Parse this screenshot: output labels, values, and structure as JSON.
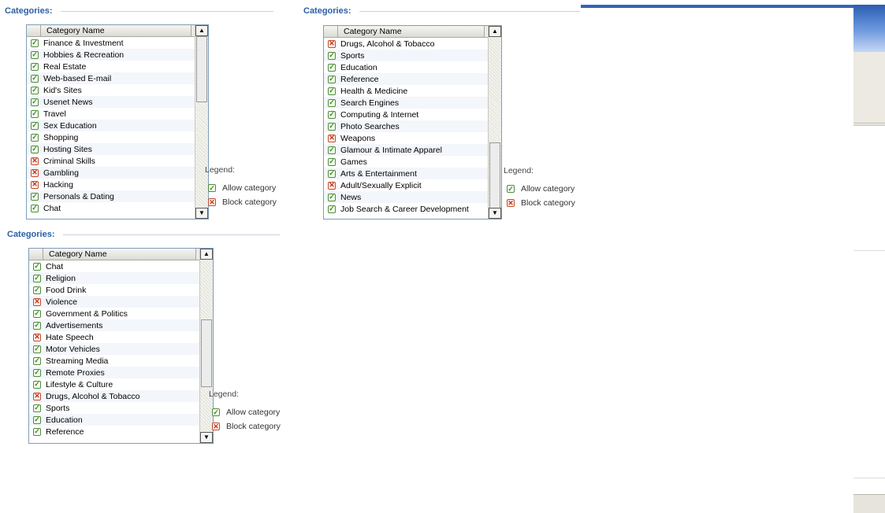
{
  "colors": {
    "title": "#2b5fa6",
    "allow": "#3f8a2a",
    "block": "#c0341a",
    "list_border": "#7f9db9"
  },
  "icons": {
    "allow": "check-icon",
    "block": "x-icon",
    "scroll_up": "arrow-up-icon",
    "scroll_down": "arrow-down-icon"
  },
  "panels": [
    {
      "title": "Categories:",
      "column_header": "Category Name",
      "scroll_up": "▲",
      "scroll_down": "▼",
      "legend": {
        "title": "Legend:",
        "allow_label": "Allow category",
        "block_label": "Block category"
      },
      "items": [
        {
          "name": "Finance & Investment",
          "status": "allow"
        },
        {
          "name": "Hobbies & Recreation",
          "status": "allow"
        },
        {
          "name": "Real Estate",
          "status": "allow"
        },
        {
          "name": "Web-based E-mail",
          "status": "allow"
        },
        {
          "name": "Kid's Sites",
          "status": "allow"
        },
        {
          "name": "Usenet News",
          "status": "allow"
        },
        {
          "name": "Travel",
          "status": "allow"
        },
        {
          "name": "Sex Education",
          "status": "allow"
        },
        {
          "name": "Shopping",
          "status": "allow"
        },
        {
          "name": "Hosting Sites",
          "status": "allow"
        },
        {
          "name": "Criminal Skills",
          "status": "block"
        },
        {
          "name": "Gambling",
          "status": "block"
        },
        {
          "name": "Hacking",
          "status": "block"
        },
        {
          "name": "Personals & Dating",
          "status": "allow"
        },
        {
          "name": "Chat",
          "status": "allow"
        }
      ]
    },
    {
      "title": "Categories:",
      "column_header": "Category Name",
      "scroll_up": "▲",
      "scroll_down": "▼",
      "legend": {
        "title": "Legend:",
        "allow_label": "Allow category",
        "block_label": "Block category"
      },
      "items": [
        {
          "name": "Drugs, Alcohol & Tobacco",
          "status": "block"
        },
        {
          "name": "Sports",
          "status": "allow"
        },
        {
          "name": "Education",
          "status": "allow"
        },
        {
          "name": "Reference",
          "status": "allow"
        },
        {
          "name": "Health & Medicine",
          "status": "allow"
        },
        {
          "name": "Search Engines",
          "status": "allow"
        },
        {
          "name": "Computing & Internet",
          "status": "allow"
        },
        {
          "name": "Photo Searches",
          "status": "allow"
        },
        {
          "name": "Weapons",
          "status": "block"
        },
        {
          "name": "Glamour & Intimate Apparel",
          "status": "allow"
        },
        {
          "name": "Games",
          "status": "allow"
        },
        {
          "name": "Arts & Entertainment",
          "status": "allow"
        },
        {
          "name": "Adult/Sexually Explicit",
          "status": "block"
        },
        {
          "name": "News",
          "status": "allow"
        },
        {
          "name": "Job Search & Career Development",
          "status": "allow"
        }
      ]
    },
    {
      "title": "Categories:",
      "column_header": "Category Name",
      "scroll_up": "▲",
      "scroll_down": "▼",
      "legend": {
        "title": "Legend:",
        "allow_label": "Allow category",
        "block_label": "Block category"
      },
      "items": [
        {
          "name": "Chat",
          "status": "allow"
        },
        {
          "name": "Religion",
          "status": "allow"
        },
        {
          "name": "Food Drink",
          "status": "allow"
        },
        {
          "name": "Violence",
          "status": "block"
        },
        {
          "name": "Government & Politics",
          "status": "allow"
        },
        {
          "name": "Advertisements",
          "status": "allow"
        },
        {
          "name": "Hate Speech",
          "status": "block"
        },
        {
          "name": "Motor Vehicles",
          "status": "allow"
        },
        {
          "name": "Streaming Media",
          "status": "allow"
        },
        {
          "name": "Remote Proxies",
          "status": "allow"
        },
        {
          "name": "Lifestyle & Culture",
          "status": "allow"
        },
        {
          "name": "Drugs, Alcohol & Tobacco",
          "status": "block"
        },
        {
          "name": "Sports",
          "status": "allow"
        },
        {
          "name": "Education",
          "status": "allow"
        },
        {
          "name": "Reference",
          "status": "allow"
        }
      ]
    }
  ]
}
